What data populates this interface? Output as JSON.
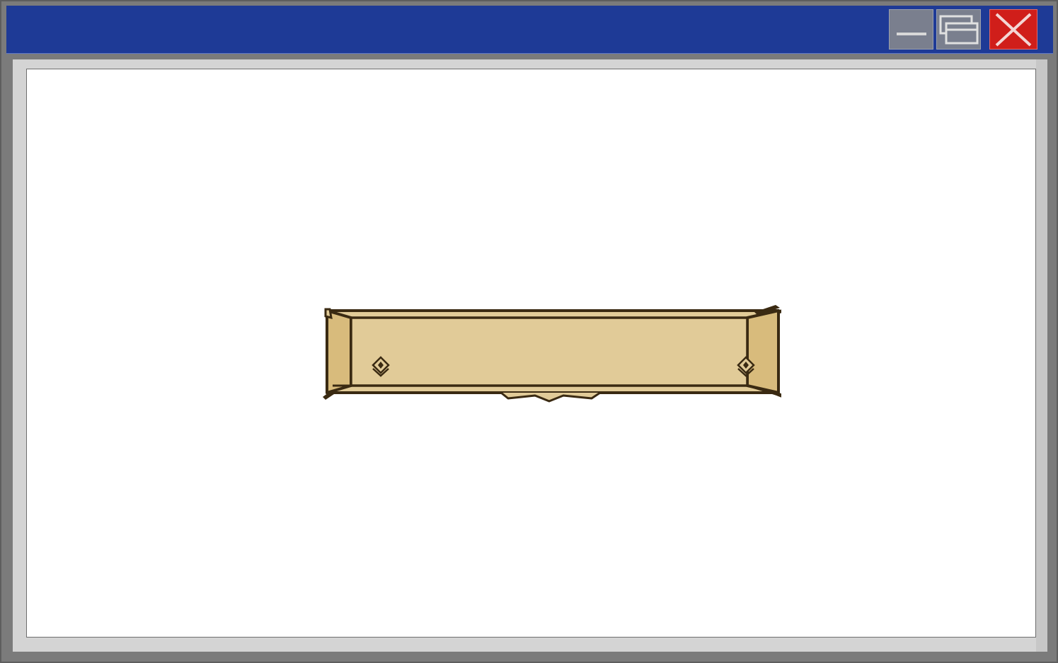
{
  "window": {
    "title": "",
    "controls": {
      "minimize_icon": "minimize-icon",
      "restore_icon": "restore-icon",
      "close_icon": "close-icon"
    }
  },
  "colors": {
    "titlebar": "#1e3a96",
    "close_button": "#d01e1a",
    "control_button": "#7a7f8e",
    "panel_fill": "#e1cb98",
    "panel_side": "#d8bb7c",
    "panel_outline": "#3a2a12"
  },
  "content": {
    "banner_panel": {
      "text": "",
      "left_ornament_icon": "diamond-ornament-icon",
      "right_ornament_icon": "diamond-ornament-icon"
    }
  }
}
